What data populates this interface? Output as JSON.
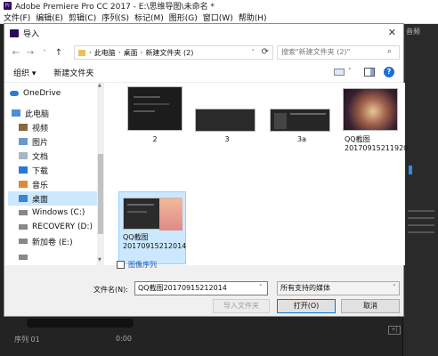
{
  "app": {
    "title": "Adobe Premiere Pro CC 2017 - E:\\思维导图\\未命名 *",
    "logo_text": "Pr",
    "menu": [
      "文件(F)",
      "编辑(E)",
      "剪辑(C)",
      "序列(S)",
      "标记(M)",
      "图形(G)",
      "窗口(W)",
      "帮助(H)"
    ],
    "right_panel_tab": "音频",
    "sequence_label": "序列 01",
    "timecode": "0:00"
  },
  "dialog": {
    "title": "导入",
    "close": "✕",
    "nav": {
      "back": "←",
      "forward": "→",
      "dropdown": "˅",
      "up": "↑"
    },
    "breadcrumb": [
      "此电脑",
      "桌面",
      "新建文件夹 (2)"
    ],
    "breadcrumb_sep": "›",
    "refresh": "⟳",
    "search_placeholder": "搜索\"新建文件夹 (2)\"",
    "search_icon": "⌕",
    "organize": "组织 ▾",
    "new_folder": "新建文件夹",
    "help": "?",
    "nav_pane": [
      {
        "label": "OneDrive",
        "icon": "cloud-icon",
        "color": "#2a7ad5"
      },
      {
        "label": "此电脑",
        "icon": "computer-icon",
        "color": "#4a90d9"
      },
      {
        "label": "视频",
        "icon": "video-folder-icon",
        "color": "#8a6a3a"
      },
      {
        "label": "图片",
        "icon": "pictures-folder-icon",
        "color": "#6a9ac9"
      },
      {
        "label": "文档",
        "icon": "documents-folder-icon",
        "color": "#aab6c4"
      },
      {
        "label": "下载",
        "icon": "downloads-folder-icon",
        "color": "#2a7ad5"
      },
      {
        "label": "音乐",
        "icon": "music-folder-icon",
        "color": "#d98a3a"
      },
      {
        "label": "桌面",
        "icon": "desktop-folder-icon",
        "color": "#3a84d9"
      },
      {
        "label": "Windows (C:)",
        "icon": "drive-c-icon",
        "color": "#888888"
      },
      {
        "label": "RECOVERY (D:)",
        "icon": "drive-d-icon",
        "color": "#888888"
      },
      {
        "label": "新加卷 (E:)",
        "icon": "drive-e-icon",
        "color": "#888888"
      },
      {
        "label": "",
        "icon": "more-icon",
        "color": "#888888"
      }
    ],
    "files": [
      {
        "label": "2"
      },
      {
        "label": "3"
      },
      {
        "label": "3a"
      },
      {
        "label": "QQ截图\n20170915211920"
      },
      {
        "label": "QQ截图\n20170915212014"
      }
    ],
    "image_sequence": "图像序列",
    "filename_label": "文件名(N):",
    "filename_value": "QQ截图20170915212014",
    "filetype_value": "所有支持的媒体",
    "import_folder": "导入文件夹",
    "open": "打开(O)",
    "cancel": "取消"
  }
}
